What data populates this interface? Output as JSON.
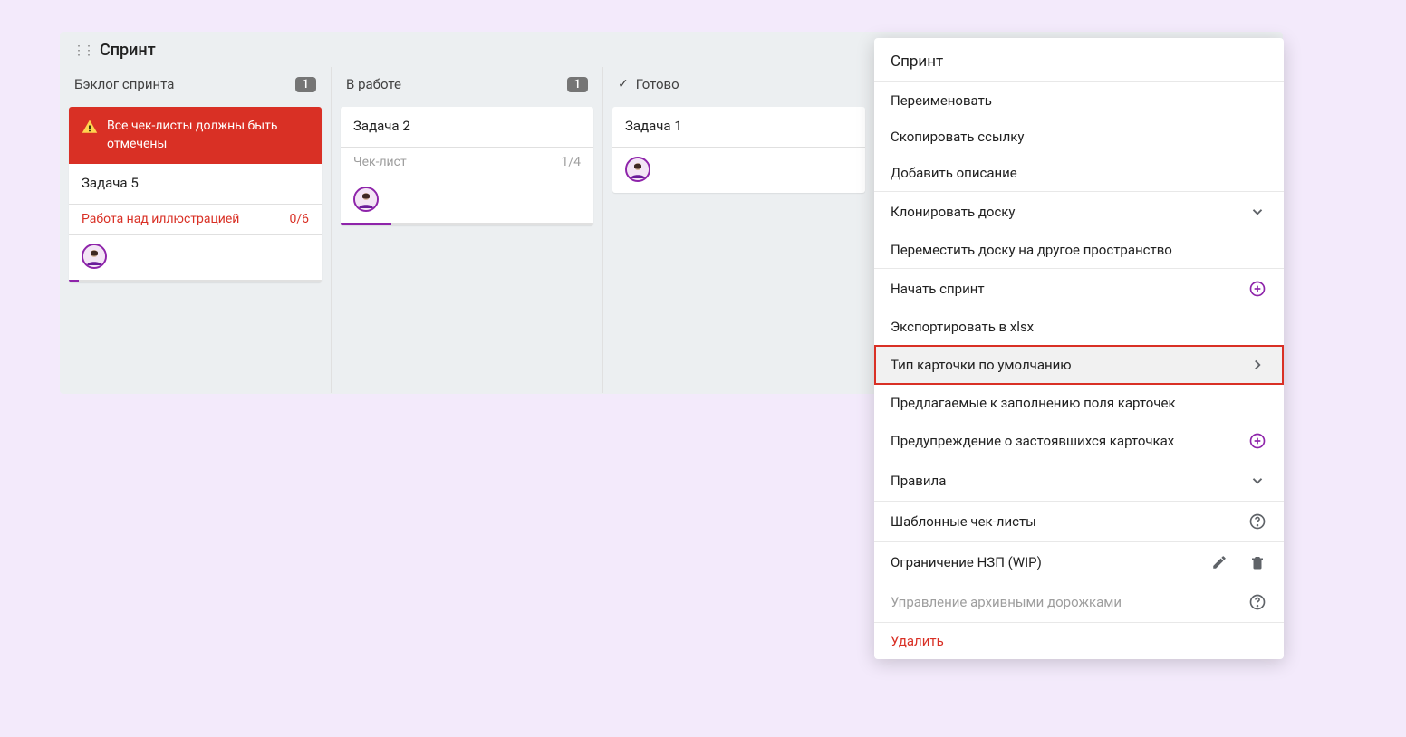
{
  "board": {
    "title": "Спринт",
    "columns": [
      {
        "title": "Бэклог спринта",
        "count": "1",
        "cards": [
          {
            "warning": "Все чек-листы должны быть отмечены",
            "title": "Задача 5",
            "checklist": {
              "label": "Работа над иллюстрацией",
              "count": "0/6",
              "danger": true
            },
            "progress_pct": 4
          }
        ]
      },
      {
        "title": "В работе",
        "count": "1",
        "cards": [
          {
            "title": "Задача 2",
            "checklist": {
              "label": "Чек-лист",
              "count": "1/4",
              "danger": false
            },
            "progress_pct": 20
          }
        ]
      },
      {
        "title": "Готово",
        "done_marker": true,
        "cards": [
          {
            "title": "Задача 1"
          }
        ]
      }
    ]
  },
  "menu": {
    "title": "Спринт",
    "items": {
      "rename": "Переименовать",
      "copy_link": "Скопировать ссылку",
      "add_desc": "Добавить описание",
      "clone_board": "Клонировать доску",
      "move_board": "Переместить доску на другое пространство",
      "start_sprint": "Начать спринт",
      "export_xlsx": "Экспортировать в xlsx",
      "default_card_type": "Тип карточки по умолчанию",
      "suggested_fields": "Предлагаемые к заполнению поля карточек",
      "stale_warning": "Предупреждение о застоявшихся карточках",
      "rules": "Правила",
      "template_checklists": "Шаблонные чек-листы",
      "wip_limit": "Ограничение НЗП (WIP)",
      "archive_lanes": "Управление архивными дорожками",
      "delete": "Удалить"
    }
  }
}
